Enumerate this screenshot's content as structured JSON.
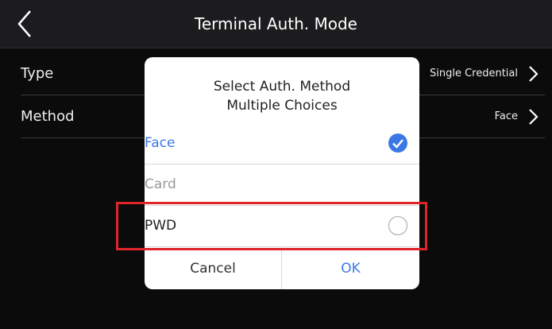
{
  "header": {
    "title": "Terminal Auth. Mode",
    "back_icon": "chevron-left-icon"
  },
  "settings": [
    {
      "label": "Type",
      "value": "Single Credential",
      "icon": "chevron-right-icon"
    },
    {
      "label": "Method",
      "value": "Face",
      "icon": "chevron-right-icon"
    }
  ],
  "dialog": {
    "title": "Select Auth. Method",
    "subtitle": "Multiple Choices",
    "options": [
      {
        "label": "Face",
        "checked": true,
        "color": "#3b78e7"
      },
      {
        "label": "Card",
        "disabled": true,
        "color": "#999999"
      },
      {
        "label": "PWD",
        "checked": false,
        "color": "#222222"
      }
    ],
    "cancel_label": "Cancel",
    "ok_label": "OK"
  },
  "colors": {
    "accent": "#3b78e7",
    "highlight": "#e0242b"
  }
}
